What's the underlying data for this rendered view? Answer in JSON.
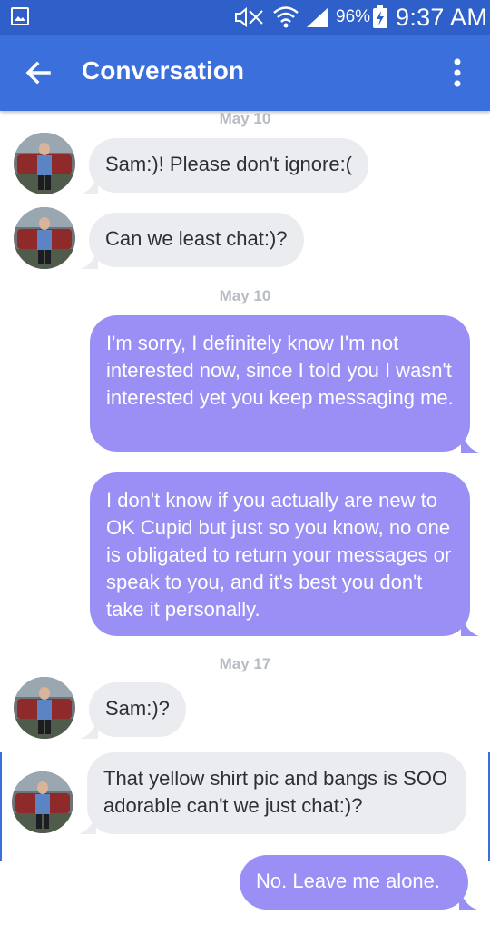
{
  "status_bar": {
    "battery_percent": "96%",
    "time": "9:37 AM",
    "icons": [
      "gallery-notification-icon",
      "mute-icon",
      "wifi-icon",
      "signal-icon",
      "battery-charging-icon"
    ]
  },
  "app_bar": {
    "title": "Conversation",
    "back_icon": "arrow-back-icon",
    "menu_icon": "more-vert-icon",
    "color": "#3b6fdb"
  },
  "conversation": {
    "date_1": "May 10",
    "msg_1": "Sam:)! Please don't ignore:(",
    "msg_2": "Can we least chat:)?",
    "date_2": "May 10",
    "msg_3": "I'm sorry, I definitely know I'm not interested now, since I told you I wasn't interested yet you keep messaging me.",
    "msg_4": "I don't know if you actually are new to OK Cupid but just so you know, no one is obligated to return your messages or speak to you, and it's best you don't take it personally.",
    "date_3": "May 17",
    "msg_5": "Sam:)?",
    "msg_6": "That yellow shirt pic and bangs is SOO adorable can't we just chat:)?",
    "msg_7": "No. Leave me alone."
  },
  "colors": {
    "incoming_bubble": "#ebecef",
    "outgoing_bubble": "#9a8ff5",
    "status_bar": "#2f5fc9"
  }
}
